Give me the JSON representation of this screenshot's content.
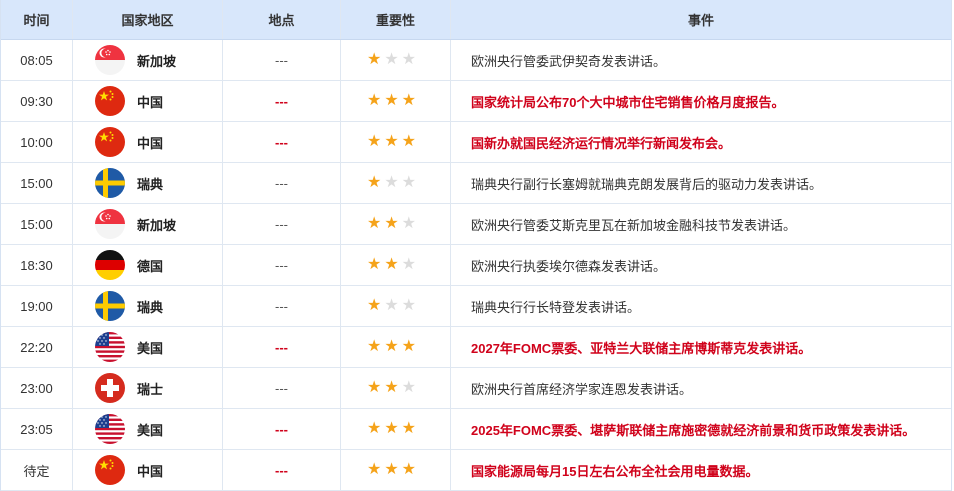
{
  "headers": {
    "time": "时间",
    "country": "国家地区",
    "location": "地点",
    "importance": "重要性",
    "event": "事件"
  },
  "rows": [
    {
      "time": "08:05",
      "country": "新加坡",
      "flag": "singapore-flag-icon",
      "location": "---",
      "stars": 1,
      "event": "欧洲央行管委武伊契奇发表讲话。",
      "highlight": false
    },
    {
      "time": "09:30",
      "country": "中国",
      "flag": "china-flag-icon",
      "location": "---",
      "stars": 3,
      "event": "国家统计局公布70个大中城市住宅销售价格月度报告。",
      "highlight": true
    },
    {
      "time": "10:00",
      "country": "中国",
      "flag": "china-flag-icon",
      "location": "---",
      "stars": 3,
      "event": "国新办就国民经济运行情况举行新闻发布会。",
      "highlight": true
    },
    {
      "time": "15:00",
      "country": "瑞典",
      "flag": "sweden-flag-icon",
      "location": "---",
      "stars": 1,
      "event": "瑞典央行副行长塞姆就瑞典克朗发展背后的驱动力发表讲话。",
      "highlight": false
    },
    {
      "time": "15:00",
      "country": "新加坡",
      "flag": "singapore-flag-icon",
      "location": "---",
      "stars": 2,
      "event": "欧洲央行管委艾斯克里瓦在新加坡金融科技节发表讲话。",
      "highlight": false
    },
    {
      "time": "18:30",
      "country": "德国",
      "flag": "germany-flag-icon",
      "location": "---",
      "stars": 2,
      "event": "欧洲央行执委埃尔德森发表讲话。",
      "highlight": false
    },
    {
      "time": "19:00",
      "country": "瑞典",
      "flag": "sweden-flag-icon",
      "location": "---",
      "stars": 1,
      "event": "瑞典央行行长特登发表讲话。",
      "highlight": false
    },
    {
      "time": "22:20",
      "country": "美国",
      "flag": "usa-flag-icon",
      "location": "---",
      "stars": 3,
      "event": "2027年FOMC票委、亚特兰大联储主席博斯蒂克发表讲话。",
      "highlight": true
    },
    {
      "time": "23:00",
      "country": "瑞士",
      "flag": "switzerland-flag-icon",
      "location": "---",
      "stars": 2,
      "event": "欧洲央行首席经济学家连恩发表讲话。",
      "highlight": false
    },
    {
      "time": "23:05",
      "country": "美国",
      "flag": "usa-flag-icon",
      "location": "---",
      "stars": 3,
      "event": "2025年FOMC票委、堪萨斯联储主席施密德就经济前景和货币政策发表讲话。",
      "highlight": true
    },
    {
      "time": "待定",
      "country": "中国",
      "flag": "china-flag-icon",
      "location": "---",
      "stars": 3,
      "event": "国家能源局每月15日左右公布全社会用电量数据。",
      "highlight": true
    }
  ]
}
